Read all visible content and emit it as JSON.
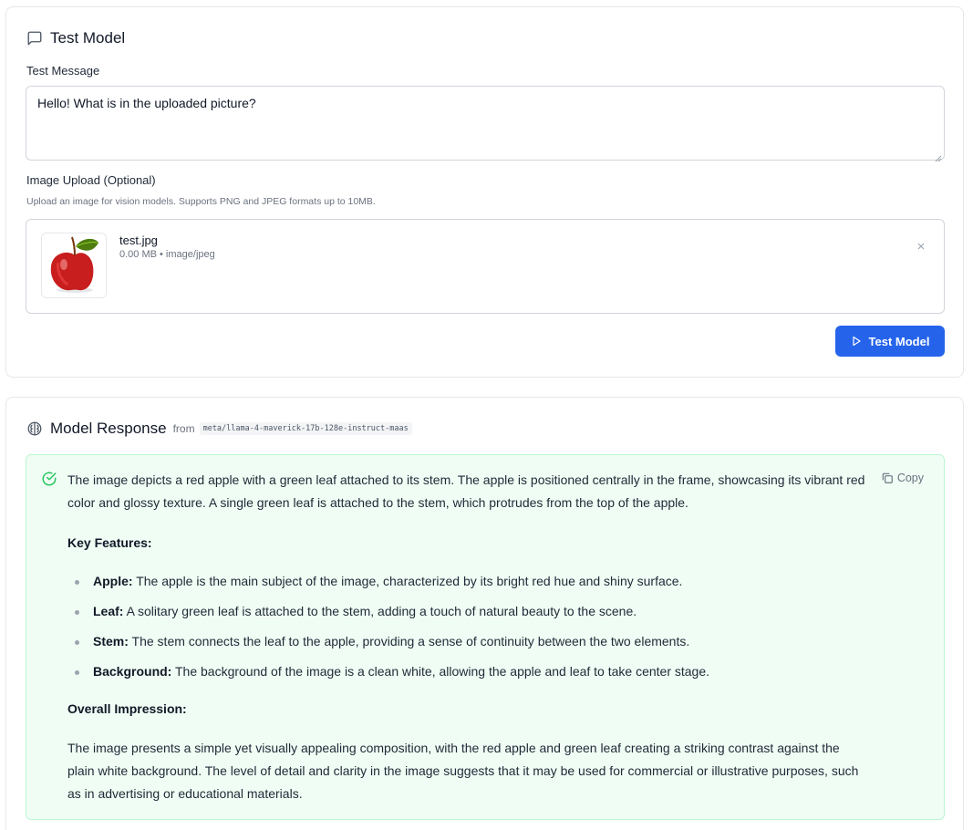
{
  "test_card": {
    "title": "Test Model",
    "message_label": "Test Message",
    "message_value": "Hello! What is in the uploaded picture?",
    "upload_label": "Image Upload (Optional)",
    "upload_help": "Upload an image for vision models. Supports PNG and JPEG formats up to 10MB.",
    "file": {
      "name": "test.jpg",
      "meta": "0.00 MB • image/jpeg"
    },
    "remove_icon": "×",
    "button_label": "Test Model"
  },
  "response_card": {
    "title": "Model Response",
    "from_label": "from",
    "model_id": "meta/llama-4-maverick-17b-128e-instruct-maas",
    "copy_label": "Copy",
    "intro": "The image depicts a red apple with a green leaf attached to its stem. The apple is positioned centrally in the frame, showcasing its vibrant red color and glossy texture. A single green leaf is attached to the stem, which protrudes from the top of the apple.",
    "features_heading": "Key Features:",
    "features": [
      {
        "term": "Apple:",
        "text": " The apple is the main subject of the image, characterized by its bright red hue and shiny surface."
      },
      {
        "term": "Leaf:",
        "text": " A solitary green leaf is attached to the stem, adding a touch of natural beauty to the scene."
      },
      {
        "term": "Stem:",
        "text": " The stem connects the leaf to the apple, providing a sense of continuity between the two elements."
      },
      {
        "term": "Background:",
        "text": " The background of the image is a clean white, allowing the apple and leaf to take center stage."
      }
    ],
    "impression_heading": "Overall Impression:",
    "impression": "The image presents a simple yet visually appealing composition, with the red apple and green leaf creating a striking contrast against the plain white background. The level of detail and clarity in the image suggests that it may be used for commercial or illustrative purposes, such as in advertising or educational materials."
  },
  "icons": {
    "title_icon": "message-square-icon",
    "response_icon": "brain-icon",
    "success_icon": "check-circle-icon",
    "copy_icon": "copy-icon",
    "play_icon": "play-icon"
  },
  "colors": {
    "primary": "#2563eb",
    "success_bg": "#f0fdf4",
    "success_border": "#bbf7d0",
    "success_icon": "#22c55e"
  }
}
